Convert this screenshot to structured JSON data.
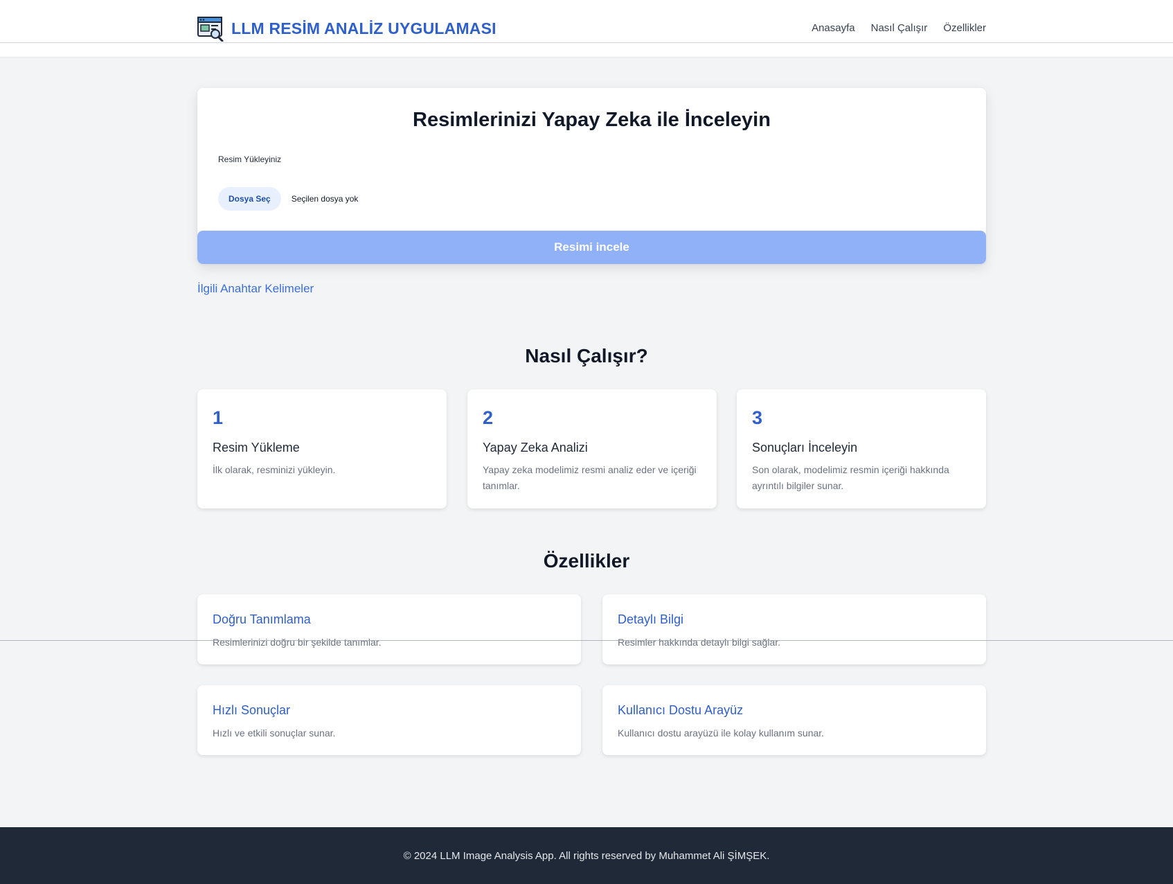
{
  "header": {
    "brand_title": "LLM RESİM ANALİZ UYGULAMASI",
    "brand_icon": "image-search-icon",
    "nav": [
      "Anasayfa",
      "Nasıl Çalışır",
      "Özellikler"
    ]
  },
  "upload": {
    "title": "Resimlerinizi Yapay Zeka ile İnceleyin",
    "label": "Resim Yükleyiniz",
    "file_button": "Dosya Seç",
    "file_status": "Seçilen dosya yok",
    "submit_label": "Resimi incele"
  },
  "keywords_link": "İlgili Anahtar Kelimeler",
  "how_it_works": {
    "title": "Nasıl Çalışır?",
    "steps": [
      {
        "number": "1",
        "title": "Resim Yükleme",
        "description": "İlk olarak, resminizi yükleyin."
      },
      {
        "number": "2",
        "title": "Yapay Zeka Analizi",
        "description": "Yapay zeka modelimiz resmi analiz eder ve içeriği tanımlar."
      },
      {
        "number": "3",
        "title": "Sonuçları İnceleyin",
        "description": "Son olarak, modelimiz resmin içeriği hakkında ayrıntılı bilgiler sunar."
      }
    ]
  },
  "features": {
    "title": "Özellikler",
    "items": [
      {
        "title": "Doğru Tanımlama",
        "description": "Resimlerinizi doğru bir şekilde tanımlar."
      },
      {
        "title": "Detaylı Bilgi",
        "description": "Resimler hakkında detaylı bilgi sağlar."
      },
      {
        "title": "Hızlı Sonuçlar",
        "description": "Hızlı ve etkili sonuçlar sunar."
      },
      {
        "title": "Kullanıcı Dostu Arayüz",
        "description": "Kullanıcı dostu arayüzü ile kolay kullanım sunar."
      }
    ]
  },
  "footer": {
    "text": "© 2024 LLM Image Analysis App. All rights reserved by Muhammet Ali ŞİMŞEK."
  },
  "colors": {
    "brand_blue": "#2f5fc9",
    "submit_button": "#90b0f8",
    "page_background": "#f3f4f6",
    "footer_background": "#1f2937"
  }
}
